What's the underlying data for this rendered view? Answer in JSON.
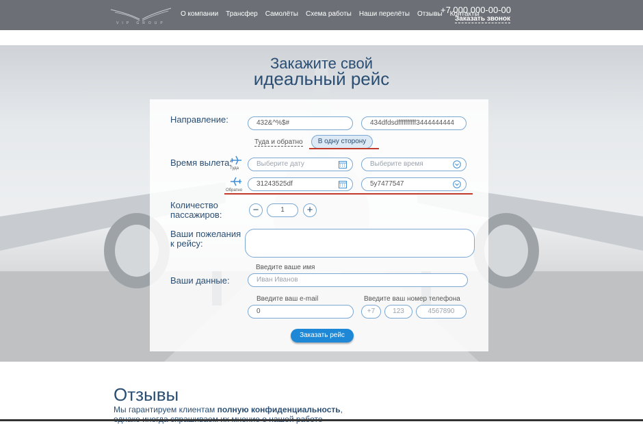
{
  "header": {
    "logo_text": "VIP GROUP",
    "nav": [
      "О компании",
      "Трансфер",
      "Самолёты",
      "Схема работы",
      "Наши перелёты",
      "Отзывы",
      "Контакты"
    ],
    "phone": "+7 000 000-00-00",
    "callback": "Заказать звонок"
  },
  "hero": {
    "title_line1": "Закажите свой",
    "title_line2": "идеальный рейс"
  },
  "form": {
    "direction_label": "Направление:",
    "from_value": "432&^%$#",
    "to_value": "434dfdsdffffffffff3444444444",
    "roundtrip_label": "Туда и обратно",
    "oneway_label": "В одну сторону",
    "departure_label": "Время вылета:",
    "there_label": "Туда",
    "back_label": "Обратно",
    "date_placeholder": "Выберите дату",
    "time_placeholder": "Выберите время",
    "return_date_value": "31243525df",
    "return_time_value": "5y7477547",
    "passengers_label_1": "Количество",
    "passengers_label_2": "пассажиров:",
    "passengers_value": "1",
    "minus": "−",
    "plus": "+",
    "wishes_label_1": "Ваши пожелания",
    "wishes_label_2": "к рейсу:",
    "data_label": "Ваши данные:",
    "name_caption": "Введите ваше имя",
    "name_placeholder": "Иван Иванов",
    "email_caption": "Введите ваш e-mail",
    "email_value": "0",
    "phone_caption": "Введите ваш номер телефона",
    "phone_code": "+7",
    "phone_area": "123",
    "phone_number": "4567890",
    "submit": "Заказать рейс"
  },
  "reviews": {
    "title": "Отзывы",
    "text_start": "Мы гарантируем клиентам ",
    "text_bold": "полную конфиденциальность",
    "text_end": ",",
    "text_line2": "однако иногда спрашиваем их мнение о нашей работе"
  },
  "colors": {
    "header_bg": "#6c7076",
    "accent": "#1e88d6",
    "title": "#2a4e73",
    "highlight": "#c0392b"
  }
}
